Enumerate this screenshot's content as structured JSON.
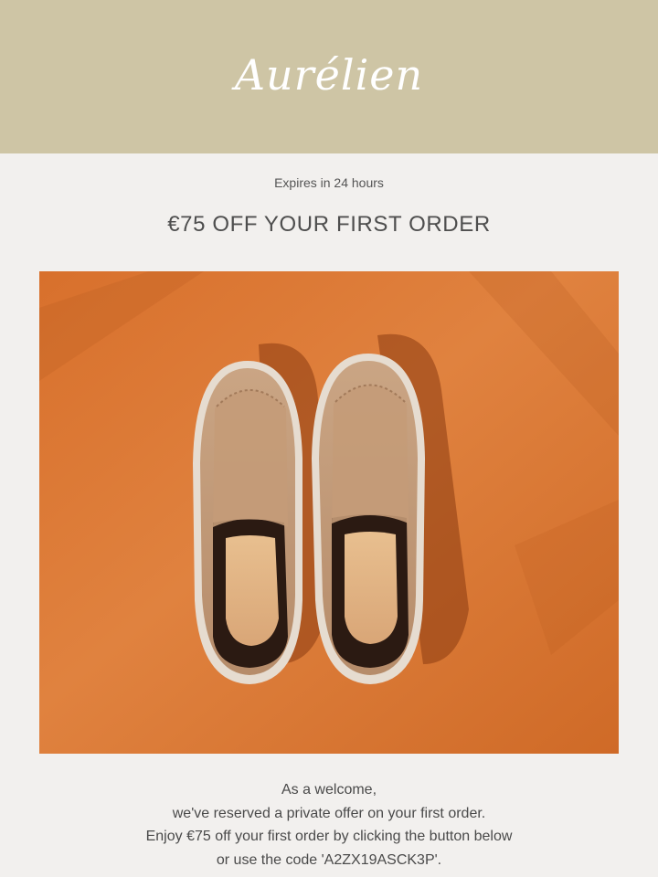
{
  "header": {
    "brand": "Aurélien",
    "background_color": "#cec5a5"
  },
  "offer": {
    "expires_text": "Expires in 24 hours",
    "headline": "€75 OFF YOUR FIRST ORDER"
  },
  "hero_image": {
    "icon": "loafers-product-photo",
    "background_color": "#dc7a35"
  },
  "body": {
    "line1": "As a welcome,",
    "line2": "we've reserved a private offer on your first order.",
    "line3": "Enjoy €75 off your first order by clicking the button below",
    "line4": "or use the code 'A2ZX19ASCK3P'."
  }
}
